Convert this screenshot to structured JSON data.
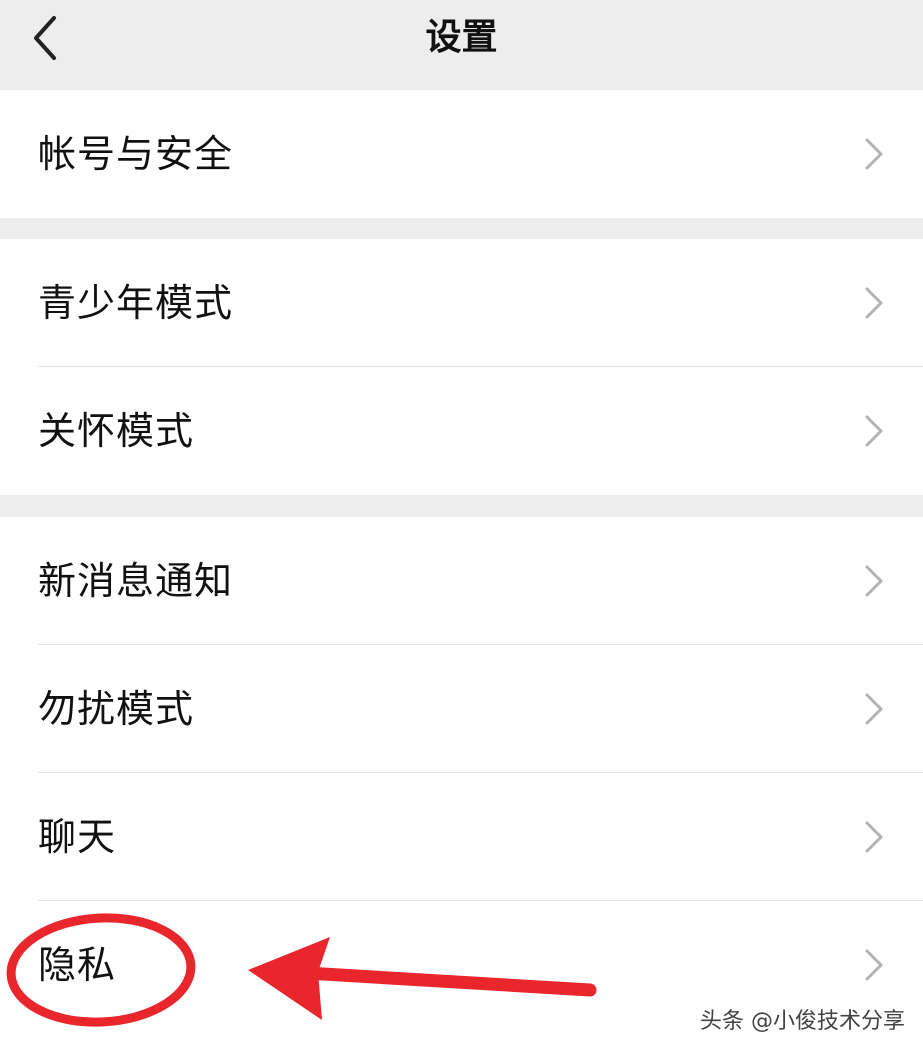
{
  "header": {
    "title": "设置",
    "back_icon": "chevron-left-icon"
  },
  "groups": [
    {
      "items": [
        {
          "label": "帐号与安全",
          "icon": "chevron-right-icon"
        }
      ]
    },
    {
      "items": [
        {
          "label": "青少年模式",
          "icon": "chevron-right-icon"
        },
        {
          "label": "关怀模式",
          "icon": "chevron-right-icon"
        }
      ]
    },
    {
      "items": [
        {
          "label": "新消息通知",
          "icon": "chevron-right-icon"
        },
        {
          "label": "勿扰模式",
          "icon": "chevron-right-icon"
        },
        {
          "label": "聊天",
          "icon": "chevron-right-icon"
        },
        {
          "label": "隐私",
          "icon": "chevron-right-icon"
        }
      ]
    }
  ],
  "annotation": {
    "highlighted_item": "隐私",
    "color": "#e8262b"
  },
  "watermark": "头条 @小俊技术分享",
  "colors": {
    "page_background": "#ededed",
    "row_background": "#ffffff",
    "chevron": "#b2b2b2",
    "divider": "#e3e3e3",
    "annotation": "#e8262b"
  }
}
